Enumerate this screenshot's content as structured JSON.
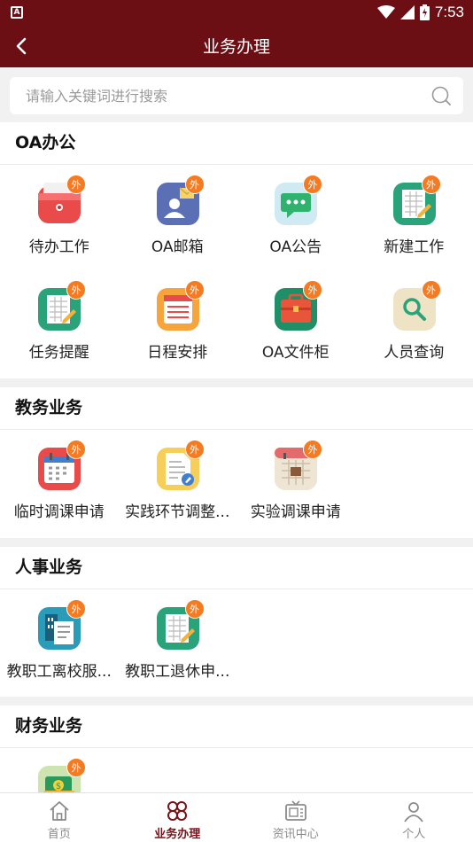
{
  "status": {
    "time": "7:53",
    "app_icon": "A"
  },
  "header": {
    "title": "业务办理"
  },
  "search": {
    "placeholder": "请输入关键词进行搜索"
  },
  "badge_text": "外",
  "sections": [
    {
      "title": "OA办公",
      "items": [
        {
          "label": "待办工作",
          "icon": "todo-icon"
        },
        {
          "label": "OA邮箱",
          "icon": "mailbox-icon"
        },
        {
          "label": "OA公告",
          "icon": "announcement-icon"
        },
        {
          "label": "新建工作",
          "icon": "new-work-icon"
        },
        {
          "label": "任务提醒",
          "icon": "task-reminder-icon"
        },
        {
          "label": "日程安排",
          "icon": "schedule-icon"
        },
        {
          "label": "OA文件柜",
          "icon": "file-cabinet-icon"
        },
        {
          "label": "人员查询",
          "icon": "people-search-icon"
        }
      ]
    },
    {
      "title": "教务业务",
      "items": [
        {
          "label": "临时调课申请",
          "icon": "calendar-icon"
        },
        {
          "label": "实践环节调整...",
          "icon": "document-edit-icon"
        },
        {
          "label": "实验调课申请",
          "icon": "lab-schedule-icon"
        }
      ]
    },
    {
      "title": "人事业务",
      "items": [
        {
          "label": "教职工离校服...",
          "icon": "leave-service-icon"
        },
        {
          "label": "教职工退休申...",
          "icon": "retirement-icon"
        }
      ]
    },
    {
      "title": "财务业务",
      "items": [
        {
          "label": "",
          "icon": "finance-icon"
        }
      ]
    }
  ],
  "tabs": [
    {
      "label": "首页",
      "icon": "home-icon",
      "active": false
    },
    {
      "label": "业务办理",
      "icon": "business-icon",
      "active": true
    },
    {
      "label": "资讯中心",
      "icon": "news-tv-icon",
      "active": false
    },
    {
      "label": "个人",
      "icon": "person-icon",
      "active": false
    }
  ],
  "colors": {
    "brand": "#6b0f14",
    "badge": "#f57b22",
    "active_tab": "#7a1018"
  }
}
